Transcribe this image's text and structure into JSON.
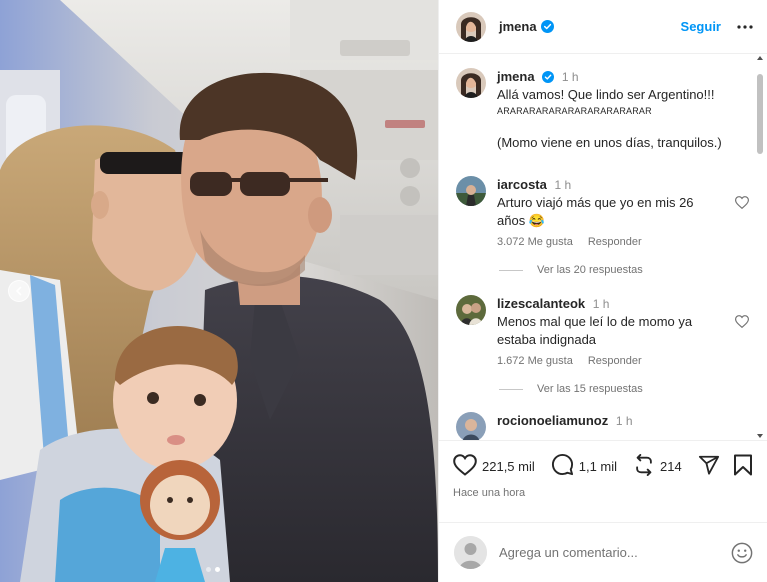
{
  "post": {
    "author": "jmena",
    "follow_label": "Seguir"
  },
  "caption": {
    "username": "jmena",
    "time": "1 h",
    "text": "Allá vamos! Que lindo ser Argentino!!!",
    "small_text": "ARARARARARARARARARARARAR",
    "note": "(Momo viene en unos días, tranquilos.)"
  },
  "comments": [
    {
      "username": "iarcosta",
      "time": "1 h",
      "text": "Arturo viajó más que yo en mis 26 años 😂",
      "likes": "3.072 Me gusta",
      "reply_label": "Responder",
      "replies_label": "Ver las 20 respuestas"
    },
    {
      "username": "lizescalanteok",
      "time": "1 h",
      "text": "Menos mal que leí lo de momo ya estaba indignada",
      "likes": "1.672 Me gusta",
      "reply_label": "Responder",
      "replies_label": "Ver las 15 respuestas"
    },
    {
      "username": "rocionoeliamunoz",
      "time": "1 h"
    }
  ],
  "actions": {
    "likes_count": "221,5 mil",
    "comments_count": "1,1 mil",
    "reposts_count": "214",
    "posted_ago": "Hace una hora"
  },
  "composer": {
    "placeholder": "Agrega un comentario..."
  },
  "icons": {
    "verified": "verified-badge-icon",
    "more": "more-options-icon",
    "heart": "heart-icon",
    "comment": "comment-bubble-icon",
    "repost": "repost-icon",
    "share": "share-send-icon",
    "bookmark": "bookmark-icon",
    "emoji": "emoji-smile-icon",
    "carousel_prev": "chevron-left-icon"
  },
  "colors": {
    "accent": "#0095f6",
    "verified": "#0095f6",
    "text": "#262626",
    "muted": "#737373"
  },
  "carousel": {
    "total": 2,
    "active": 2
  }
}
